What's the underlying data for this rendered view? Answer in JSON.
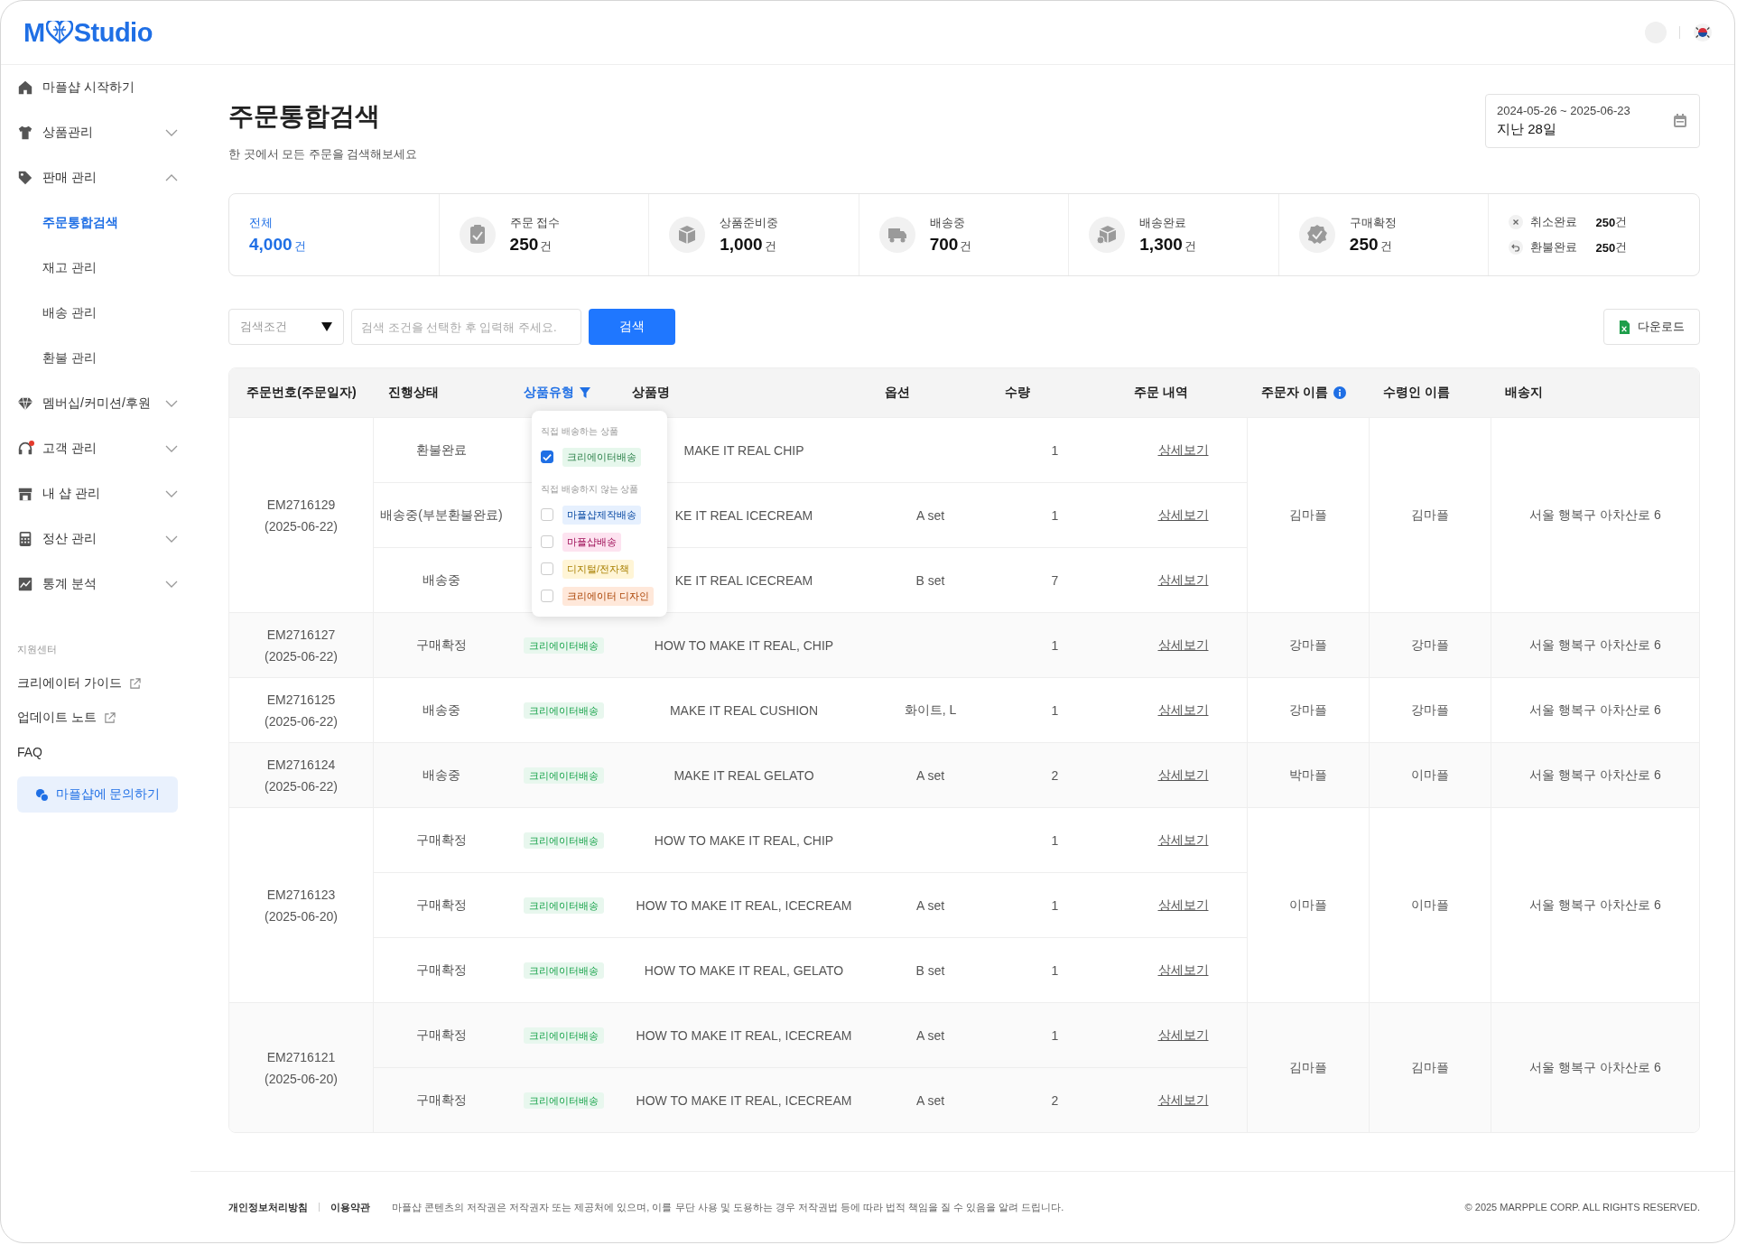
{
  "header": {
    "logo_left": "M",
    "logo_right": "Studio"
  },
  "sidebar": {
    "items": [
      {
        "label": "마플샵 시작하기",
        "kind": "home"
      },
      {
        "label": "상품관리",
        "kind": "shirt",
        "expanded": false
      },
      {
        "label": "판매 관리",
        "kind": "tag",
        "expanded": true,
        "children": [
          {
            "label": "주문통합검색",
            "selected": true
          },
          {
            "label": "재고 관리",
            "selected": false
          },
          {
            "label": "배송 관리",
            "selected": false
          },
          {
            "label": "환불 관리",
            "selected": false
          }
        ]
      },
      {
        "label": "멤버십/커미션/후원",
        "kind": "diamond",
        "expanded": false
      },
      {
        "label": "고객 관리",
        "kind": "headset",
        "expanded": false,
        "alert": true
      },
      {
        "label": "내 샵 관리",
        "kind": "store",
        "expanded": false
      },
      {
        "label": "정산 관리",
        "kind": "calculator",
        "expanded": false
      },
      {
        "label": "통계 분석",
        "kind": "chart",
        "expanded": false
      }
    ],
    "support_title": "지원센터",
    "support_links": [
      {
        "label": "크리에이터 가이드",
        "external": true
      },
      {
        "label": "업데이트 노트",
        "external": true
      },
      {
        "label": "FAQ",
        "external": false
      }
    ],
    "contact_button": "마플샵에 문의하기"
  },
  "page": {
    "title": "주문통합검색",
    "subtitle": "한 곳에서 모든 주문을 검색해보세요",
    "date_range": "2024-05-26 ~ 2025-06-23",
    "date_preset": "지난 28일"
  },
  "stats": [
    {
      "label": "전체",
      "value": "4,000",
      "unit": "건",
      "selected": true,
      "kind": "total"
    },
    {
      "label": "주문 접수",
      "value": "250",
      "unit": "건",
      "selected": false,
      "kind": "received"
    },
    {
      "label": "상품준비중",
      "value": "1,000",
      "unit": "건",
      "selected": false,
      "kind": "preparing"
    },
    {
      "label": "배송중",
      "value": "700",
      "unit": "건",
      "selected": false,
      "kind": "shipping"
    },
    {
      "label": "배송완료",
      "value": "1,300",
      "unit": "건",
      "selected": false,
      "kind": "delivered"
    },
    {
      "label": "구매확정",
      "value": "250",
      "unit": "건",
      "selected": false,
      "kind": "confirmed"
    }
  ],
  "stats_minor": [
    {
      "label": "취소완료",
      "value": "250",
      "unit": "건",
      "kind": "cancelled"
    },
    {
      "label": "환불완료",
      "value": "250",
      "unit": "건",
      "kind": "refunded"
    }
  ],
  "search": {
    "condition": "검색조건",
    "placeholder": "검색 조건을 선택한 후 입력해 주세요.",
    "button": "검색",
    "download": "다운로드"
  },
  "table": {
    "columns": [
      {
        "label": "주문번호(주문일자)",
        "kind": "plain"
      },
      {
        "label": "진행상태",
        "kind": "plain"
      },
      {
        "label": "상품유형",
        "kind": "filter"
      },
      {
        "label": "상품명",
        "kind": "plain"
      },
      {
        "label": "옵션",
        "kind": "plain"
      },
      {
        "label": "수량",
        "kind": "plain"
      },
      {
        "label": "주문 내역",
        "kind": "plain"
      },
      {
        "label": "주문자 이름",
        "kind": "info"
      },
      {
        "label": "수령인 이름",
        "kind": "plain"
      },
      {
        "label": "배송지",
        "kind": "plain"
      }
    ],
    "orders": [
      {
        "order_no": "EM2716129",
        "date": "(2025-06-22)",
        "orderer": "김마플",
        "recipient": "김마플",
        "address": "서울 행복구 아차산로 6",
        "items": [
          {
            "status": "환불완료",
            "product": "MAKE IT REAL CHIP",
            "qty": "1",
            "detail": "상세보기"
          },
          {
            "status": "배송중(부분환불완료)",
            "product": "KE IT REAL ICECREAM",
            "option": "A set",
            "qty": "1",
            "detail": "상세보기"
          },
          {
            "status": "배송중",
            "product": "KE IT REAL ICECREAM",
            "option": "B set",
            "qty": "7",
            "detail": "상세보기"
          }
        ]
      },
      {
        "order_no": "EM2716127",
        "date": "(2025-06-22)",
        "orderer": "강마플",
        "recipient": "강마플",
        "address": "서울 행복구 아차산로 6",
        "items": [
          {
            "status": "구매확정",
            "type": "크리에이터배송",
            "product": "HOW TO MAKE IT REAL, CHIP",
            "qty": "1",
            "detail": "상세보기"
          }
        ]
      },
      {
        "order_no": "EM2716125",
        "date": "(2025-06-22)",
        "orderer": "강마플",
        "recipient": "강마플",
        "address": "서울 행복구 아차산로 6",
        "items": [
          {
            "status": "배송중",
            "type": "크리에이터배송",
            "product": "MAKE IT REAL CUSHION",
            "option": "화이트, L",
            "qty": "1",
            "detail": "상세보기"
          }
        ]
      },
      {
        "order_no": "EM2716124",
        "date": "(2025-06-22)",
        "orderer": "박마플",
        "recipient": "이마플",
        "address": "서울 행복구 아차산로 6",
        "items": [
          {
            "status": "배송중",
            "type": "크리에이터배송",
            "product": "MAKE IT REAL GELATO",
            "option": "A set",
            "qty": "2",
            "detail": "상세보기"
          }
        ]
      },
      {
        "order_no": "EM2716123",
        "date": "(2025-06-20)",
        "orderer": "이마플",
        "recipient": "이마플",
        "address": "서울 행복구 아차산로 6",
        "items": [
          {
            "status": "구매확정",
            "type": "크리에이터배송",
            "product": "HOW TO MAKE IT REAL, CHIP",
            "qty": "1",
            "detail": "상세보기"
          },
          {
            "status": "구매확정",
            "type": "크리에이터배송",
            "product": "HOW TO MAKE IT REAL, ICECREAM",
            "option": "A set",
            "qty": "1",
            "detail": "상세보기"
          },
          {
            "status": "구매확정",
            "type": "크리에이터배송",
            "product": "HOW TO MAKE IT REAL, GELATO",
            "option": "B set",
            "qty": "1",
            "detail": "상세보기"
          }
        ]
      },
      {
        "order_no": "EM2716121",
        "date": "(2025-06-20)",
        "orderer": "김마플",
        "recipient": "김마플",
        "address": "서울 행복구 아차산로 6",
        "items": [
          {
            "status": "구매확정",
            "type": "크리에이터배송",
            "product": "HOW TO MAKE IT REAL, ICECREAM",
            "option": "A set",
            "qty": "1",
            "detail": "상세보기"
          },
          {
            "status": "구매확정",
            "type": "크리에이터배송",
            "product": "HOW TO MAKE IT REAL, ICECREAM",
            "option": "A set",
            "qty": "2",
            "detail": "상세보기"
          }
        ]
      }
    ]
  },
  "type_filter": {
    "groups": [
      {
        "title": "직접 배송하는 상품",
        "options": [
          {
            "label": "크리에이터배송",
            "checked": true,
            "color": "#e6f7ec"
          }
        ]
      },
      {
        "title": "직접 배송하지 않는 상품",
        "options": [
          {
            "label": "마플샵제작배송",
            "checked": false,
            "color": "#e6f0fe"
          },
          {
            "label": "마플샵배송",
            "checked": false,
            "color": "#fde3f0"
          },
          {
            "label": "디지털/전자책",
            "checked": false,
            "color": "#fff5d6"
          },
          {
            "label": "크리에이터 디자인",
            "checked": false,
            "color": "#ffe8da"
          }
        ]
      }
    ]
  },
  "footer": {
    "links": [
      "개인정보처리방침",
      "이용약관"
    ],
    "notice": "마플샵 콘텐츠의 저작권은 저작권자 또는 제공처에 있으며, 이를 무단 사용 및 도용하는 경우 저작권법 등에 따라 법적 책임을 질 수 있음을 알려 드립니다.",
    "copyright": "© 2025 MARPPLE CORP.  ALL RIGHTS RESERVED."
  }
}
